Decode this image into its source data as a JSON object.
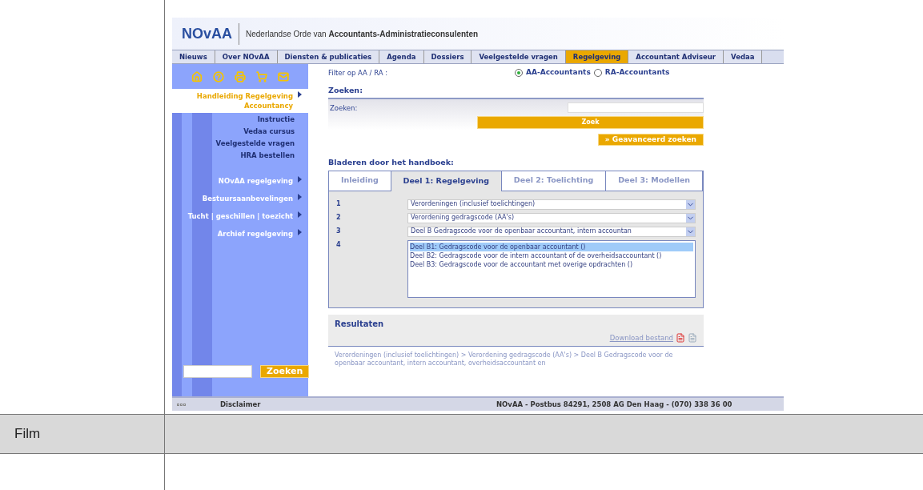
{
  "site": {
    "logo": "NOvAA",
    "tagline": "Nederlandse Orde van **Accountants-Administratieconsulenten**"
  },
  "nav": [
    {
      "label": "Nieuws",
      "selected": false
    },
    {
      "label": "Over NOvAA",
      "selected": false
    },
    {
      "label": "Diensten & publicaties",
      "selected": false
    },
    {
      "label": "Agenda",
      "selected": false
    },
    {
      "label": "Dossiers",
      "selected": false
    },
    {
      "label": "Veelgestelde vragen",
      "selected": false
    },
    {
      "label": "Regelgeving",
      "selected": true
    },
    {
      "label": "Accountant Adviseur",
      "selected": false
    },
    {
      "label": "Vedaa",
      "selected": false
    }
  ],
  "sidebar": {
    "menu": [
      {
        "label": "Handleiding Regelgeving Accountancy",
        "selected": true,
        "children": [
          {
            "label": "Instructie"
          },
          {
            "label": "Vedaa cursus"
          },
          {
            "label": "Veelgestelde vragen"
          },
          {
            "label": "HRA bestellen"
          }
        ]
      },
      {
        "label": "NOvAA regelgeving",
        "selected": false
      },
      {
        "label": "Bestuursaanbevelingen",
        "selected": false
      },
      {
        "label": "Tucht | geschillen | toezicht",
        "selected": false
      },
      {
        "label": "Archief regelgeving",
        "selected": false
      }
    ],
    "search_button": "Zoeken"
  },
  "filter": {
    "label": "Filter op AA / RA :",
    "options": [
      {
        "label": "AA-Accountants",
        "selected": true
      },
      {
        "label": "RA-Accountants",
        "selected": false
      }
    ]
  },
  "search": {
    "heading": "Zoeken:",
    "label": "Zoeken:",
    "button": "Zoek",
    "advanced": "» Geavanceerd zoeken"
  },
  "browse": {
    "heading": "Bladeren door het handboek:",
    "tabs": [
      {
        "label": "Inleiding",
        "selected": false
      },
      {
        "label": "Deel 1: Regelgeving",
        "selected": true
      },
      {
        "label": "Deel 2: Toelichting",
        "selected": false
      },
      {
        "label": "Deel 3: Modellen",
        "selected": false
      }
    ],
    "rows": [
      {
        "number": "1",
        "value": "Verordeningen (inclusief toelichtingen)"
      },
      {
        "number": "2",
        "value": "Verordening gedragscode (AA's)"
      },
      {
        "number": "3",
        "value": "Deel B Gedragscode voor de openbaar accountant, intern accountan"
      }
    ],
    "list_number": "4",
    "list": [
      {
        "label": "Deel B1: Gedragscode voor de openbaar accountant ()",
        "selected": true
      },
      {
        "label": "Deel B2: Gedragscode voor de intern accountant of de overheidsaccountant ()",
        "selected": false
      },
      {
        "label": "Deel B3: Gedragscode voor de accountant met overige opdrachten ()",
        "selected": false
      }
    ]
  },
  "results": {
    "heading": "Resultaten",
    "download": "Download bestand",
    "path": "Verordeningen (inclusief toelichtingen) > Verordening gedragscode (AA's) > Deel B Gedragscode voor de openbaar accountant, intern accountant, overheidsaccountant en"
  },
  "footer": {
    "disclaimer": "Disclaimer",
    "address": "NOvAA - Postbus 84291, 2508 AG Den Haag - (070) 338 36 00"
  },
  "table_row": {
    "label": "Film"
  }
}
